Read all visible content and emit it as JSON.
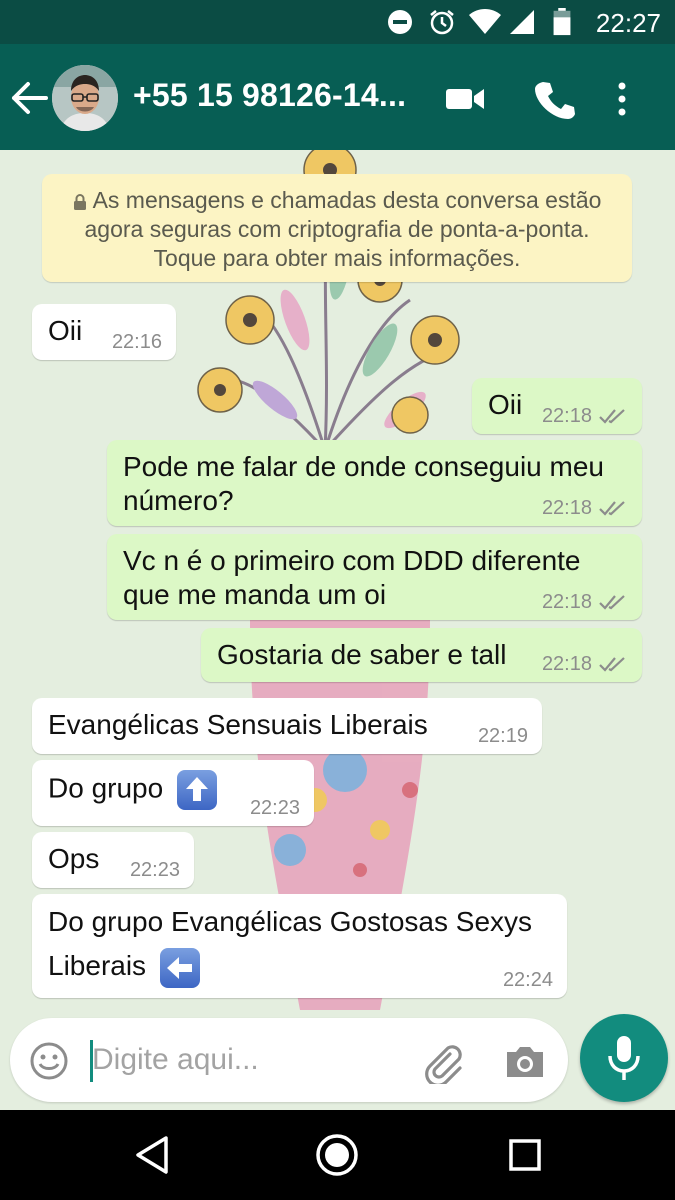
{
  "statusbar": {
    "time": "22:27"
  },
  "header": {
    "contact": "+55 15 98126-14..."
  },
  "chat": {
    "encryption_notice": "As mensagens e chamadas desta conversa estão agora seguras com criptografia de ponta-a-ponta. Toque para obter mais informações.",
    "messages": [
      {
        "direction": "in",
        "text": "Oii",
        "time": "22:16"
      },
      {
        "direction": "out",
        "text": "Oii",
        "time": "22:18"
      },
      {
        "direction": "out",
        "text": "Pode me falar de onde conseguiu meu número?",
        "time": "22:18"
      },
      {
        "direction": "out",
        "text": "Vc n é o primeiro com DDD diferente que me manda um oi",
        "time": "22:18"
      },
      {
        "direction": "out",
        "text": "Gostaria de saber e tall",
        "time": "22:18"
      },
      {
        "direction": "in",
        "text": "Evangélicas Sensuais Liberais",
        "time": "22:19"
      },
      {
        "direction": "in",
        "text": "Do grupo",
        "emoji": "up-arrow-emoji",
        "time": "22:23"
      },
      {
        "direction": "in",
        "text": "Ops",
        "time": "22:23"
      },
      {
        "direction": "in",
        "text": "Do grupo Evangélicas Gostosas Sexys Liberais",
        "emoji": "left-arrow-emoji",
        "time": "22:24"
      }
    ]
  },
  "composer": {
    "placeholder": "Digite aqui..."
  },
  "colors": {
    "header": "#075e54",
    "statusbar": "#0b4c44",
    "outgoing": "#dcf8c6",
    "incoming": "#ffffff",
    "accent": "#128c7e"
  }
}
